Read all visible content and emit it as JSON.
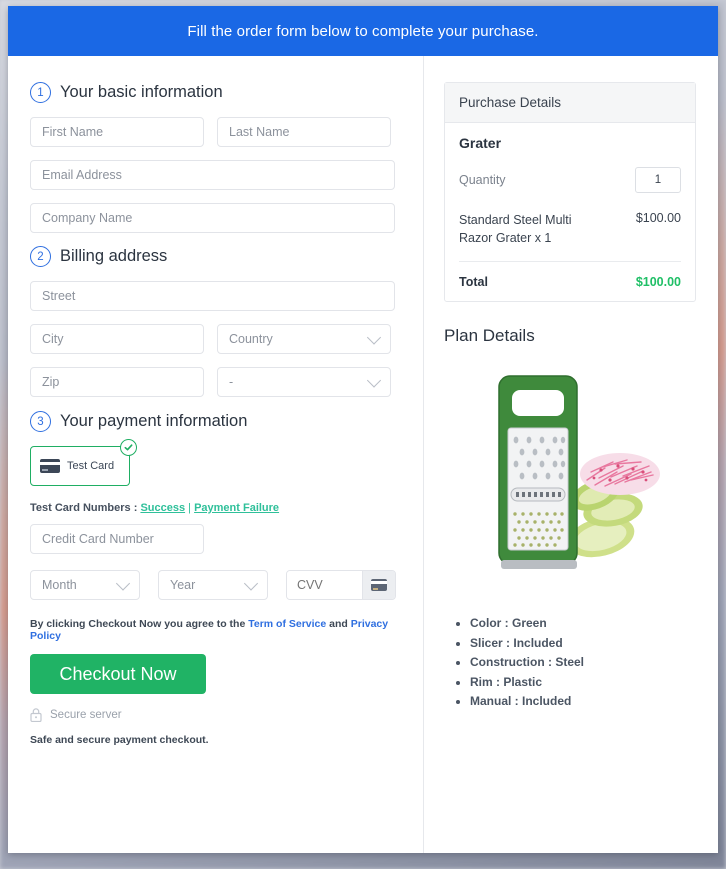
{
  "banner": {
    "text": "Fill the order form below to complete your purchase."
  },
  "steps": {
    "basic": {
      "num": "1",
      "title": "Your basic information"
    },
    "billing": {
      "num": "2",
      "title": "Billing address"
    },
    "payment": {
      "num": "3",
      "title": "Your payment information"
    }
  },
  "fields": {
    "first_name": "First Name",
    "last_name": "Last Name",
    "email": "Email Address",
    "company": "Company Name",
    "street": "Street",
    "city": "City",
    "country": "Country",
    "zip": "Zip",
    "state": "-",
    "credit_card": "Credit Card Number",
    "month": "Month",
    "year": "Year",
    "cvv": "CVV"
  },
  "payment_method": {
    "label": "Test Card",
    "selected": true,
    "icon": "credit-card-icon",
    "badge_icon": "check-circle-icon",
    "border_color": "#1fae63"
  },
  "test_cards": {
    "prefix": "Test Card Numbers :",
    "success": "Success",
    "separator": "|",
    "failure": "Payment Failure",
    "link_color": "#2fc09a"
  },
  "terms": {
    "before": "By clicking Checkout Now you agree to the ",
    "tos": "Term of Service",
    "middle": " and ",
    "privacy": "Privacy Policy",
    "link_color": "#2f6fe0"
  },
  "checkout": {
    "button_label": "Checkout Now",
    "button_color": "#20b365",
    "secure_icon": "lock-icon",
    "secure_label": "Secure server",
    "safe_note": "Safe and secure payment checkout."
  },
  "purchase_details": {
    "header": "Purchase Details",
    "product_name": "Grater",
    "quantity_label": "Quantity",
    "quantity_value": "1",
    "line_item": "Standard Steel Multi Razor Grater x 1",
    "line_amount": "$100.00",
    "total_label": "Total",
    "total_amount": "$100.00",
    "total_color": "#1fbf66"
  },
  "plan_details": {
    "title": "Plan Details",
    "image_alt": "green-box-grater-with-cucumber-slices",
    "bullets": [
      "Color : Green",
      "Slicer : Included",
      "Construction : Steel",
      "Rim : Plastic",
      "Manual : Included"
    ]
  },
  "theme": {
    "banner_blue": "#1a68e5",
    "step_blue": "#2f6fe0",
    "border_gray": "#e2e4e9"
  }
}
